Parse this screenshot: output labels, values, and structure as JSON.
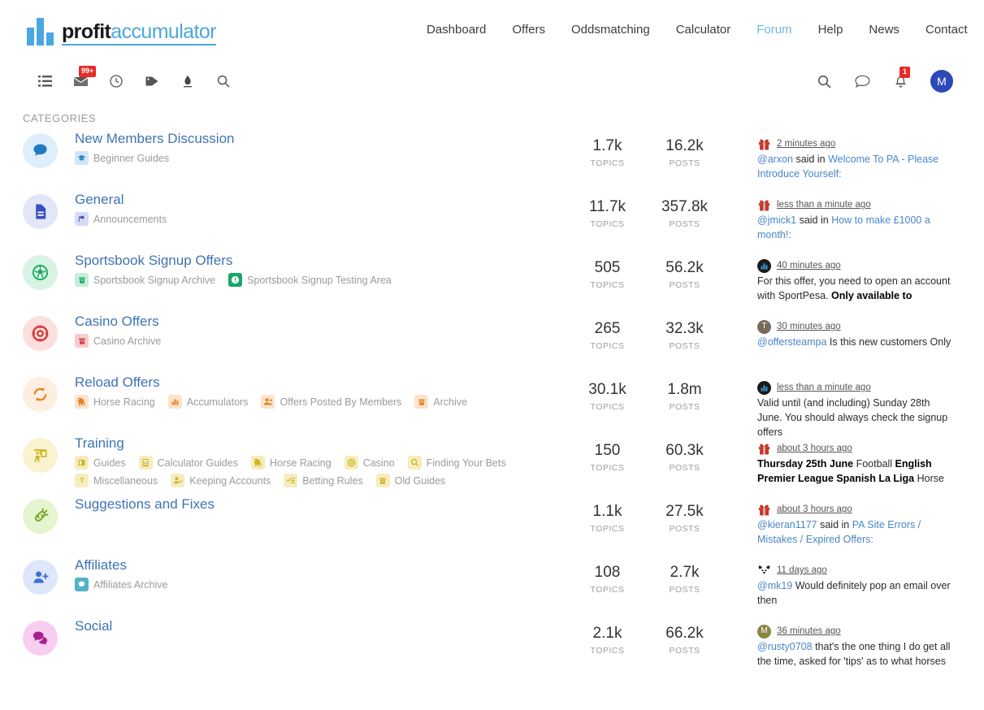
{
  "brand": {
    "part1": "profit",
    "part2": "accumulator"
  },
  "mainnav": [
    {
      "label": "Dashboard",
      "active": false
    },
    {
      "label": "Offers",
      "active": false
    },
    {
      "label": "Oddsmatching",
      "active": false
    },
    {
      "label": "Calculator",
      "active": false
    },
    {
      "label": "Forum",
      "active": true
    },
    {
      "label": "Help",
      "active": false
    },
    {
      "label": "News",
      "active": false
    },
    {
      "label": "Contact",
      "active": false
    }
  ],
  "toolbar": {
    "left": [
      {
        "name": "list-icon",
        "badge": ""
      },
      {
        "name": "unread-mail-icon",
        "badge": "99+"
      },
      {
        "name": "clock-icon",
        "badge": ""
      },
      {
        "name": "tag-icon",
        "badge": ""
      },
      {
        "name": "pin-icon",
        "badge": ""
      },
      {
        "name": "search-icon",
        "badge": ""
      }
    ],
    "right": [
      {
        "name": "search-icon",
        "badge": ""
      },
      {
        "name": "chat-bubble-icon",
        "badge": ""
      },
      {
        "name": "bell-icon",
        "badge": "1"
      }
    ],
    "avatar_initial": "M"
  },
  "categories_heading": "CATEGORIES",
  "labels": {
    "topics": "TOPICS",
    "posts": "POSTS"
  },
  "colors": {
    "accent_blue": "#4aa7e0",
    "title_blue": "#3f73b5",
    "badge_red": "#e62b2b",
    "avatar_blue": "#2c49b8"
  },
  "categories": [
    {
      "title": "New Members Discussion",
      "icon": "speech-bubble-icon",
      "icon_bg": "#dfeefb",
      "icon_fg": "#1f7cc0",
      "subs": [
        {
          "label": "Beginner Guides",
          "icon": "graduation-cap-icon",
          "bg": "#cfe6f8",
          "fg": "#2a86c6"
        }
      ],
      "topics": "1.7k",
      "posts": "16.2k",
      "last": {
        "avatar": "gift-icon",
        "avatar_bg": "#c0392b",
        "avatar_text": "",
        "time": "2 minutes ago",
        "user": "@arxon",
        "middle": " said in ",
        "link": "Welcome To PA - Please Introduce Yourself:",
        "plain": ""
      }
    },
    {
      "title": "General",
      "icon": "document-icon",
      "icon_bg": "#e2e6f7",
      "icon_fg": "#3b4fc0",
      "subs": [
        {
          "label": "Announcements",
          "icon": "megaphone-icon",
          "bg": "#d6dcf5",
          "fg": "#3b4fc0"
        }
      ],
      "topics": "11.7k",
      "posts": "357.8k",
      "last": {
        "avatar": "gift-icon",
        "avatar_bg": "#c0392b",
        "avatar_text": "",
        "time": "less than a minute ago",
        "user": "@jmick1",
        "middle": " said in ",
        "link": "How to make £1000 a month!:",
        "plain": ""
      }
    },
    {
      "title": "Sportsbook Signup Offers",
      "icon": "football-icon",
      "icon_bg": "#d8f3e4",
      "icon_fg": "#1faa63",
      "subs": [
        {
          "label": "Sportsbook Signup Archive",
          "icon": "archive-icon",
          "bg": "#c6efda",
          "fg": "#1faa63"
        },
        {
          "label": "Sportsbook Signup Testing Area",
          "icon": "exclamation-circle-icon",
          "bg": "#16a765",
          "fg": "#ffffff"
        }
      ],
      "topics": "505",
      "posts": "56.2k",
      "last": {
        "avatar": "bar-chart-icon",
        "avatar_bg": "#1a1a1a",
        "avatar_text": "",
        "time": "40 minutes ago",
        "user": "",
        "middle": "",
        "link": "",
        "plain": "For this offer, you need to open an account with SportPesa. ",
        "bold_tail": "Only available to"
      }
    },
    {
      "title": "Casino Offers",
      "icon": "casino-chip-icon",
      "icon_bg": "#fbdede",
      "icon_fg": "#d63b3b",
      "subs": [
        {
          "label": "Casino Archive",
          "icon": "archive-icon",
          "bg": "#f7cccc",
          "fg": "#d63b3b"
        }
      ],
      "topics": "265",
      "posts": "32.3k",
      "last": {
        "avatar": "letter-avatar",
        "avatar_bg": "#7a6a5a",
        "avatar_text": "T",
        "time": "30 minutes ago",
        "user": "@offersteampa",
        "middle": " Is this new customers Only",
        "link": "",
        "plain": ""
      }
    },
    {
      "title": "Reload Offers",
      "icon": "refresh-icon",
      "icon_bg": "#fceee0",
      "icon_fg": "#e8821e",
      "subs": [
        {
          "label": "Horse Racing",
          "icon": "horse-icon",
          "bg": "#fbe3cc",
          "fg": "#e8821e"
        },
        {
          "label": "Accumulators",
          "icon": "bar-chart-icon",
          "bg": "#fbe3cc",
          "fg": "#e8821e"
        },
        {
          "label": "Offers Posted By Members",
          "icon": "users-icon",
          "bg": "#fbe3cc",
          "fg": "#e8821e"
        },
        {
          "label": "Archive",
          "icon": "archive-icon",
          "bg": "#fbe3cc",
          "fg": "#e8821e"
        }
      ],
      "topics": "30.1k",
      "posts": "1.8m",
      "last": {
        "avatar": "bar-chart-icon",
        "avatar_bg": "#1a1a1a",
        "avatar_text": "",
        "time": "less than a minute ago",
        "user": "",
        "middle": "",
        "link": "",
        "plain": "Valid until (and including) Sunday 28th June. You should always check the signup offers"
      }
    },
    {
      "title": "Training",
      "icon": "presentation-icon",
      "icon_bg": "#f9f3cf",
      "icon_fg": "#cbb521",
      "subs": [
        {
          "label": "Guides",
          "icon": "book-icon",
          "bg": "#f5edbe",
          "fg": "#cbb521"
        },
        {
          "label": "Calculator Guides",
          "icon": "calculator-icon",
          "bg": "#f5edbe",
          "fg": "#cbb521"
        },
        {
          "label": "Horse Racing",
          "icon": "horse-icon",
          "bg": "#f5edbe",
          "fg": "#cbb521"
        },
        {
          "label": "Casino",
          "icon": "casino-chip-icon",
          "bg": "#f5edbe",
          "fg": "#cbb521"
        },
        {
          "label": "Finding Your Bets",
          "icon": "search-icon",
          "bg": "#f5edbe",
          "fg": "#cbb521"
        },
        {
          "label": "Miscellaneous",
          "icon": "question-icon",
          "bg": "#f5edbe",
          "fg": "#cbb521"
        },
        {
          "label": "Keeping Accounts",
          "icon": "user-check-icon",
          "bg": "#f5edbe",
          "fg": "#cbb521"
        },
        {
          "label": "Betting Rules",
          "icon": "checklist-icon",
          "bg": "#f5edbe",
          "fg": "#cbb521"
        },
        {
          "label": "Old Guides",
          "icon": "archive-icon",
          "bg": "#f5edbe",
          "fg": "#cbb521"
        }
      ],
      "topics": "150",
      "posts": "60.3k",
      "last": {
        "avatar": "gift-icon",
        "avatar_bg": "#c0392b",
        "avatar_text": "",
        "time": "about 3 hours ago",
        "user": "",
        "middle": "",
        "link": "",
        "plain": "",
        "rich": "Thursday 25th June| Football |English Premier League Spanish La Liga |Horse"
      }
    },
    {
      "title": "Suggestions and Fixes",
      "icon": "broken-link-icon",
      "icon_bg": "#e4f5cf",
      "icon_fg": "#7aa828",
      "subs": [],
      "topics": "1.1k",
      "posts": "27.5k",
      "last": {
        "avatar": "gift-icon",
        "avatar_bg": "#c0392b",
        "avatar_text": "",
        "time": "about 3 hours ago",
        "user": "@kieran1177",
        "middle": " said in ",
        "link": "PA Site Errors / Mistakes / Expired Offers:",
        "plain": ""
      }
    },
    {
      "title": "Affiliates",
      "icon": "user-plus-icon",
      "icon_bg": "#dde6fa",
      "icon_fg": "#3b6fd4",
      "subs": [
        {
          "label": "Affiliates Archive",
          "icon": "speech-bubble-icon",
          "bg": "#4fb3c4",
          "fg": "#ffffff"
        }
      ],
      "topics": "108",
      "posts": "2.7k",
      "last": {
        "avatar": "dog-icon",
        "avatar_bg": "#ffffff",
        "avatar_text": "",
        "time": "11 days ago",
        "user": "@mk19",
        "middle": " Would definitely pop an email over then",
        "link": "",
        "plain": ""
      }
    },
    {
      "title": "Social",
      "icon": "chats-icon",
      "icon_bg": "#f7cef0",
      "icon_fg": "#a8208f",
      "subs": [],
      "topics": "2.1k",
      "posts": "66.2k",
      "last": {
        "avatar": "letter-avatar",
        "avatar_bg": "#8a8540",
        "avatar_text": "M",
        "time": "36 minutes ago",
        "user": "@rusty0708",
        "middle": " that's the one thing I do get all the time, asked for 'tips' as to what horses",
        "link": "",
        "plain": ""
      }
    }
  ]
}
